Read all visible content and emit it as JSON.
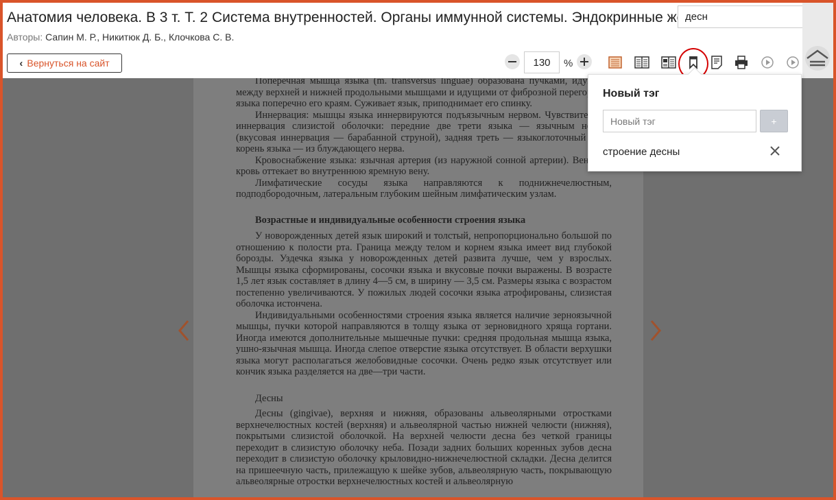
{
  "header": {
    "title": "Анатомия человека. В 3 т. Т. 2 Система внутренностей. Органы иммунной системы. Эндокринные железы",
    "authors_label": "Авторы:",
    "authors": "Сапин М. Р., Никитюк Д. Б., Клочкова С. В.",
    "back_label": "Вернуться на сайт"
  },
  "search": {
    "value": "десн"
  },
  "toolbar": {
    "zoom_value": "130",
    "zoom_unit": "%",
    "icons": [
      "single-page-icon",
      "two-page-icon",
      "page-spread-icon",
      "bookmark-icon",
      "notes-icon",
      "print-icon",
      "play-icon",
      "play-next-icon"
    ]
  },
  "popover": {
    "title": "Новый тэг",
    "input_placeholder": "Новый тэг",
    "add_label": "+",
    "tags": [
      "строение десны"
    ]
  },
  "page": {
    "p1": "Поперечная мышца языка (m. transversus linguae) образована пучками, идущими между верхней и нижней продольными мышцами и идущими от фиброзной перегородки языка поперечно его краям. Суживает язык, приподнимает его спинку.",
    "p2": "Иннервация: мышцы языка иннервируются подъязычным нервом. Чувствительная иннервация слизистой оболочки: передние две трети языка — язычным нервом (вкусовая иннервация — барабанной струной), задняя треть — языкоглоточный нерв, корень языка — из блуждающего нерва.",
    "p3": "Кровоснабжение языка: язычная артерия (из наружной сонной артерии). Венозная кровь оттекает во внутреннюю яремную вену.",
    "p4": "Лимфатические сосуды языка направляются к поднижнечелюстным, подподбородочным, латеральным глубоким шейным лимфатическим узлам.",
    "heading": "Возрастные и индивидуальные особенности строения языка",
    "p5": "У новорожденных детей язык широкий и толстый, непропорционально большой по отношению к полости рта. Граница между телом и корнем языка имеет вид глубокой борозды. Уздечка языка у новорожденных детей развита лучше, чем у взрослых. Мышцы языка сформированы, сосочки языка и вкусовые почки выражены. В возрасте 1,5 лет язык составляет в длину 4—5 см, в ширину — 3,5 см. Размеры языка с возрастом постепенно увеличиваются. У пожилых людей сосочки языка атрофированы, слизистая оболочка истончена.",
    "p6": "Индивидуальными особенностями строения языка является наличие зерноязычной мышцы, пучки которой направляются в толщу языка от зерновидного хряща гортани. Иногда имеются дополнительные мышечные пучки: средняя продольная мышца языка, ушно-язычная мышца. Иногда слепое отверстие языка отсутствует. В области верхушки языка могут располагаться желобовидные сосочки. Очень редко язык отсутствует или кончик языка разделяется на две—три части.",
    "section": "Десны",
    "p7": "Десны (gingivae), верхняя и нижняя, образованы альвеолярными отростками верхнечелюстных костей (верхняя) и альвеолярной частью нижней челюсти (нижняя), покрытыми слизистой оболочкой. На верхней челюсти десна без четкой границы переходит в слизистую оболочку неба. Позади задних больших коренных зубов десна переходит в слизистую оболочку крыловидно-нижнечелюстной складки. Десна делится на пришеечную часть, прилежащую к шейке зубов, альвеолярную часть, покрывающую альвеолярные отростки верхнечелюстных костей и альвеолярную"
  },
  "colors": {
    "accent": "#d9542a",
    "overlay": "#6f6f6f",
    "highlight_ring": "#d40000"
  }
}
